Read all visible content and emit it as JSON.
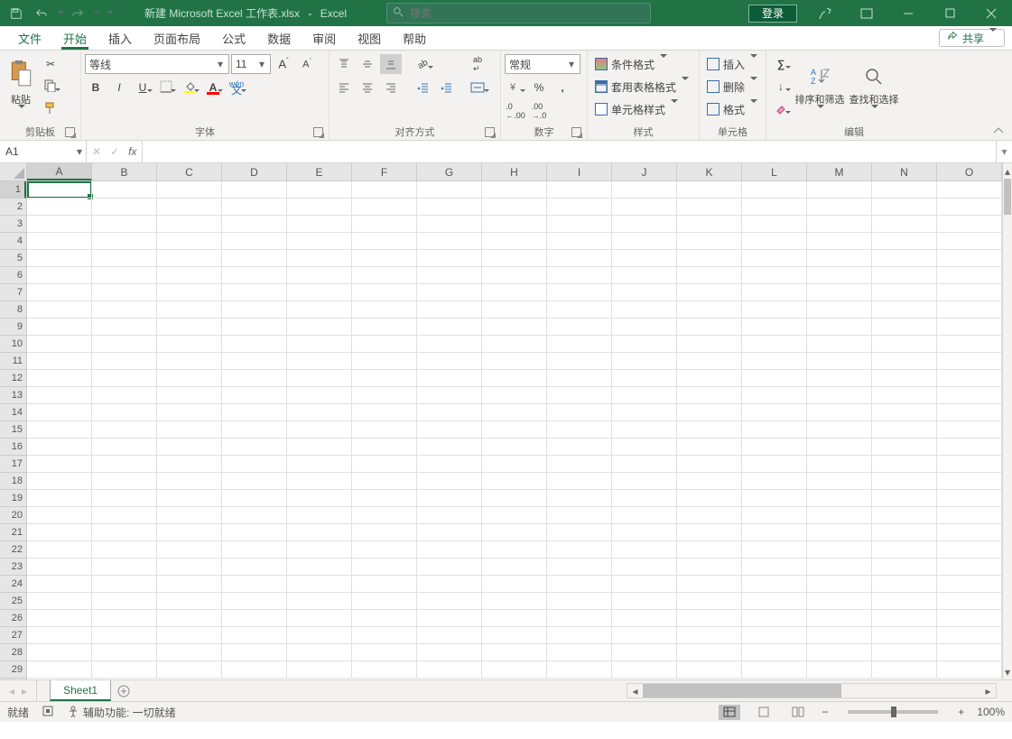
{
  "titlebar": {
    "filename": "新建 Microsoft Excel 工作表.xlsx",
    "app": "Excel",
    "search_placeholder": "搜索",
    "login": "登录"
  },
  "tabs": {
    "file": "文件",
    "home": "开始",
    "insert": "插入",
    "layout": "页面布局",
    "formulas": "公式",
    "data": "数据",
    "review": "审阅",
    "view": "视图",
    "help": "帮助",
    "share": "共享"
  },
  "ribbon": {
    "clipboard": {
      "paste": "粘贴",
      "label": "剪贴板"
    },
    "font": {
      "name": "等线",
      "size": "11",
      "label": "字体"
    },
    "align": {
      "label": "对齐方式"
    },
    "number": {
      "format": "常规",
      "label": "数字"
    },
    "styles": {
      "cond": "条件格式",
      "table": "套用表格格式",
      "cell": "单元格样式",
      "label": "样式"
    },
    "cells": {
      "insert": "插入",
      "delete": "删除",
      "format": "格式",
      "label": "单元格"
    },
    "editing": {
      "sort": "排序和筛选",
      "find": "查找和选择",
      "label": "编辑"
    }
  },
  "formula_bar": {
    "name": "A1"
  },
  "grid": {
    "cols": [
      "A",
      "B",
      "C",
      "D",
      "E",
      "F",
      "G",
      "H",
      "I",
      "J",
      "K",
      "L",
      "M",
      "N",
      "O"
    ],
    "rows": 29
  },
  "sheet": {
    "name": "Sheet1"
  },
  "status": {
    "ready": "就绪",
    "access": "辅助功能: 一切就绪",
    "zoom": "100%"
  }
}
